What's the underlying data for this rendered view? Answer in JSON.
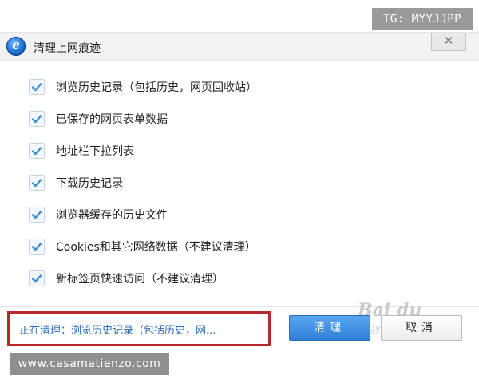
{
  "window": {
    "title": "清理上网痕迹",
    "close_label": "✕",
    "logo_letter": "e"
  },
  "options": [
    {
      "label": "浏览历史记录（包括历史，网页回收站）",
      "checked": true
    },
    {
      "label": "已保存的网页表单数据",
      "checked": true
    },
    {
      "label": "地址栏下拉列表",
      "checked": true
    },
    {
      "label": "下载历史记录",
      "checked": true
    },
    {
      "label": "浏览器缓存的历史文件",
      "checked": true
    },
    {
      "label": "Cookies和其它网络数据（不建议清理）",
      "checked": true
    },
    {
      "label": "新标签页快速访问（不建议清理）",
      "checked": true
    }
  ],
  "status": {
    "text": "正在清理：浏览历史记录（包括历史，网..."
  },
  "buttons": {
    "clean_label": "清理",
    "cancel_label": "取消"
  },
  "overlays": {
    "telegram_tag": "TG: MYYJJPP",
    "site_tag": "www.casamatienzo.com",
    "watermark_line1": "Bai du",
    "watermark_line2": "jingyan"
  },
  "colors": {
    "check": "#3a8fd8",
    "status_text": "#2a6db5",
    "highlight_border": "#b52a2a",
    "primary_button": "#3f8fe0"
  }
}
